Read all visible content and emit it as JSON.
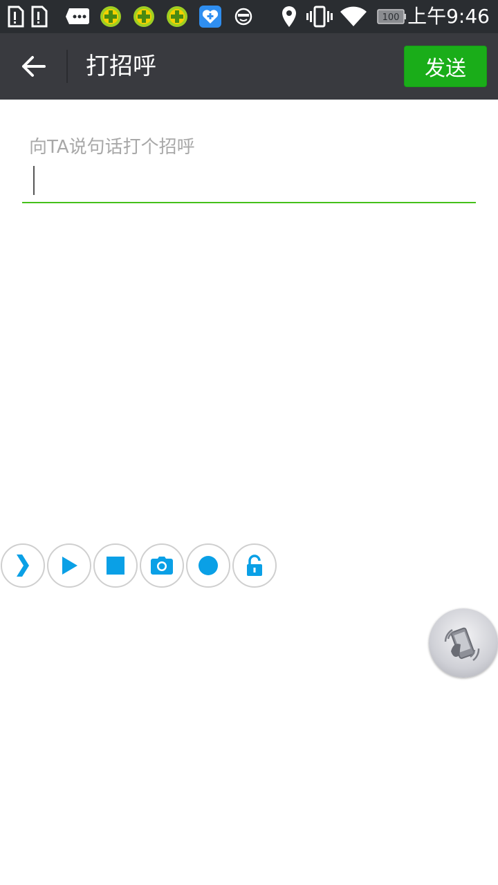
{
  "status_bar": {
    "time": "上午9:46",
    "battery_level": "100",
    "icons": [
      "sim-card-1-icon",
      "sim-card-2-icon",
      "message-icon",
      "360-security-icon",
      "360-security-icon",
      "360-security-icon",
      "health-icon",
      "face-icon",
      "location-icon",
      "vibrate-icon",
      "wifi-icon",
      "battery-icon"
    ]
  },
  "app_bar": {
    "title": "打招呼",
    "send_label": "发送"
  },
  "input": {
    "placeholder": "向TA说句话打个招呼",
    "value": ""
  },
  "float_toolbar": {
    "buttons": [
      "collapse-chevron-icon",
      "play-icon",
      "stop-icon",
      "camera-icon",
      "record-icon",
      "unlock-icon"
    ],
    "accent_color": "#0aa0e6"
  },
  "colors": {
    "app_bar": "#393a3f",
    "status_bar": "#2a2d31",
    "send_button": "#1aad19",
    "underline": "#45c01a"
  }
}
